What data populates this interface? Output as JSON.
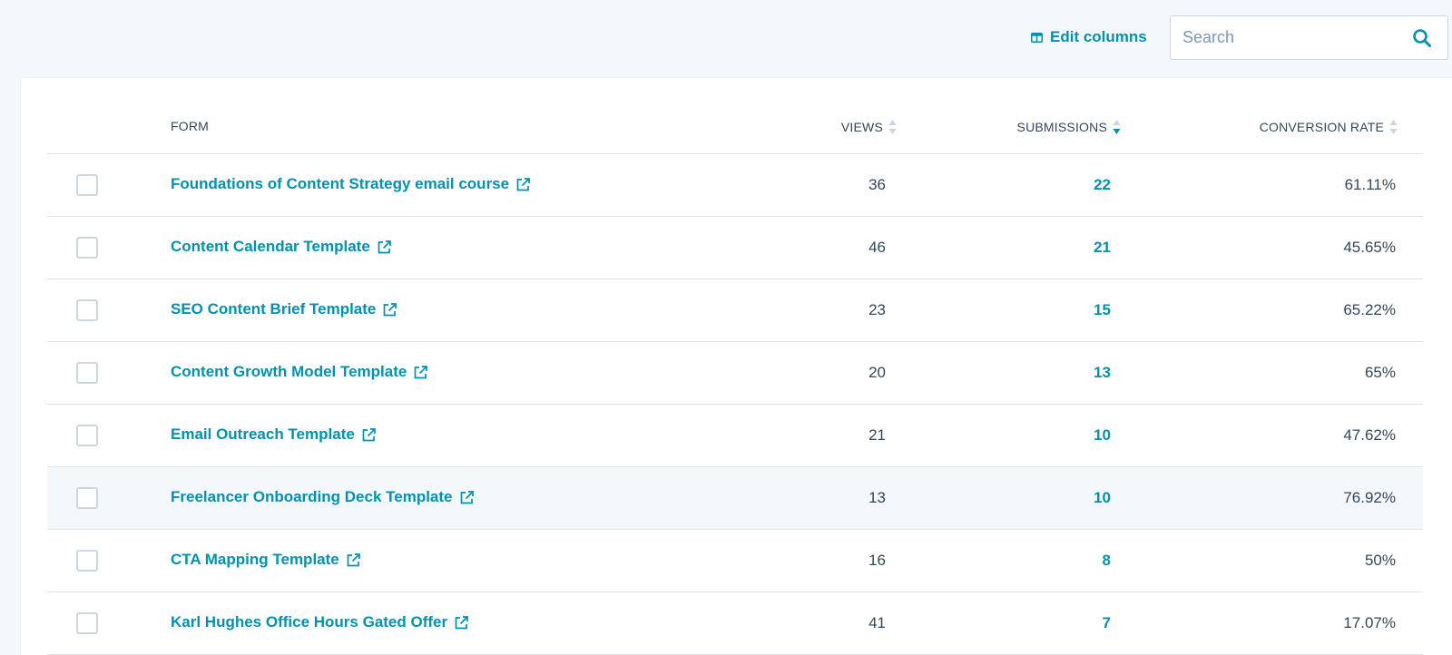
{
  "toolbar": {
    "edit_columns_label": "Edit columns",
    "search_placeholder": "Search"
  },
  "table": {
    "headers": {
      "form": "FORM",
      "views": "VIEWS",
      "submissions": "SUBMISSIONS",
      "conversion_rate": "CONVERSION RATE"
    },
    "sorted_by": "submissions",
    "sort_direction": "descending",
    "rows": [
      {
        "form": "Foundations of Content Strategy email course",
        "views": "36",
        "submissions": "22",
        "conversion_rate": "61.11%"
      },
      {
        "form": "Content Calendar Template",
        "views": "46",
        "submissions": "21",
        "conversion_rate": "45.65%"
      },
      {
        "form": "SEO Content Brief Template",
        "views": "23",
        "submissions": "15",
        "conversion_rate": "65.22%"
      },
      {
        "form": "Content Growth Model Template",
        "views": "20",
        "submissions": "13",
        "conversion_rate": "65%"
      },
      {
        "form": "Email Outreach Template",
        "views": "21",
        "submissions": "10",
        "conversion_rate": "47.62%"
      },
      {
        "form": "Freelancer Onboarding Deck Template",
        "views": "13",
        "submissions": "10",
        "conversion_rate": "76.92%"
      },
      {
        "form": "CTA Mapping Template",
        "views": "16",
        "submissions": "8",
        "conversion_rate": "50%"
      },
      {
        "form": "Karl Hughes Office Hours Gated Offer",
        "views": "41",
        "submissions": "7",
        "conversion_rate": "17.07%"
      }
    ]
  },
  "colors": {
    "accent": "#0091ae",
    "text": "#33475b",
    "border": "#dfe3eb",
    "background": "#f5f8fa"
  },
  "icons": {
    "edit_columns": "columns-icon",
    "search": "search-icon",
    "row_link": "external-link-icon",
    "sort": "sort-arrows-icon"
  }
}
